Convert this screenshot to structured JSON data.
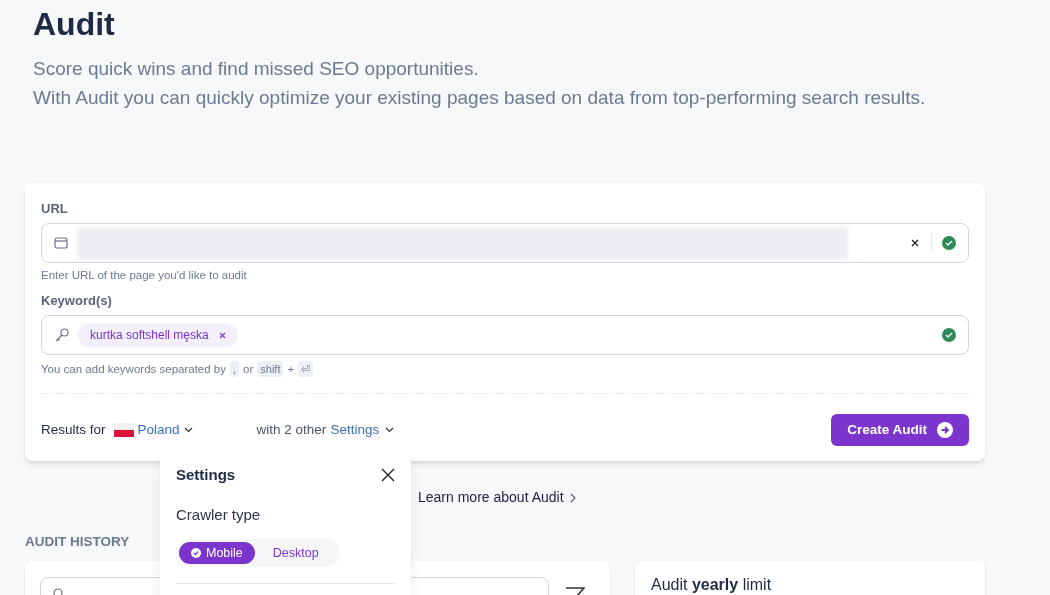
{
  "header": {
    "title": "Audit",
    "subtitle_lines": [
      "Score quick wins and find missed SEO opportunities.",
      "With Audit you can quickly optimize your existing pages based on data from top-performing search results."
    ]
  },
  "form": {
    "url_label": "URL",
    "url_valid": true,
    "url_hint": "Enter URL of the page you'd like to audit",
    "keywords_label": "Keyword(s)",
    "keywords": [
      {
        "text": "kurtka softshell męska"
      }
    ],
    "keywords_valid": true,
    "keywords_hint": [
      "You can add keywords separated by",
      ",",
      "or",
      "shift",
      "+",
      "⏎"
    ],
    "results_for": "Results for",
    "country": "Poland",
    "settings_prefix": "with 2 other",
    "settings_link": "Settings",
    "submit": "Create Audit"
  },
  "learn_more": "Learn more about Audit",
  "settings_popover": {
    "title": "Settings",
    "section": "Crawler type",
    "options": [
      {
        "label": "Mobile",
        "selected": true
      },
      {
        "label": "Desktop",
        "selected": false
      }
    ]
  },
  "history": {
    "title": "AUDIT HISTORY"
  },
  "limit": {
    "title": "Audit **yearly** limit"
  }
}
